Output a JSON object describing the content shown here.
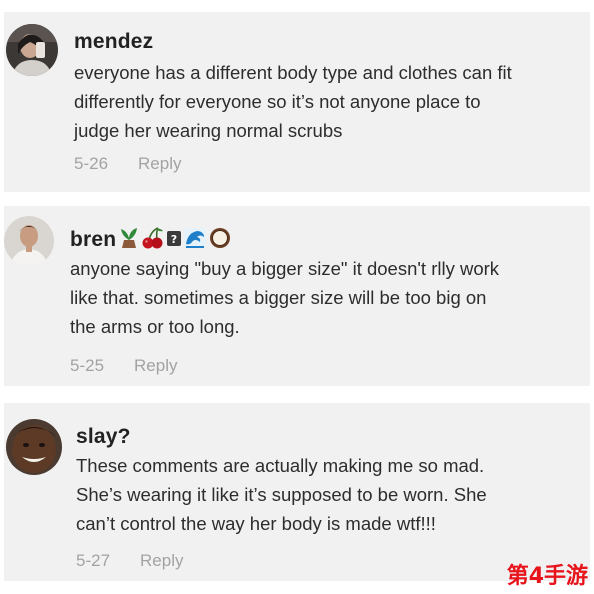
{
  "comments": [
    {
      "username": "mendez",
      "lines": [
        "everyone has a different body type and clothes can fit",
        "differently for everyone so it’s not anyone place to",
        "judge her wearing normal scrubs"
      ],
      "date": "5-26",
      "reply_label": "Reply"
    },
    {
      "username": "bren",
      "emojis": [
        "plant-icon",
        "cherries-icon",
        "question-box-icon",
        "wave-icon",
        "coconut-icon"
      ],
      "lines": [
        "anyone saying \"buy a bigger size\" it doesn't rlly work",
        "like that. sometimes a bigger size will be too big on",
        "the arms or too long."
      ],
      "date": "5-25",
      "reply_label": "Reply"
    },
    {
      "username": "slay?",
      "lines": [
        "These comments are actually making me so mad.",
        "She’s wearing it like it’s supposed to be worn. She",
        "can’t control the way her body is made wtf!!!"
      ],
      "date": "5-27",
      "reply_label": "Reply"
    }
  ],
  "watermark": "第4手游",
  "colors": {
    "card_bg": "#f1f1f1",
    "username": "#222222",
    "body_text": "#2d2d2d",
    "meta_text": "#a3a3a3",
    "watermark": "#e8141b"
  }
}
